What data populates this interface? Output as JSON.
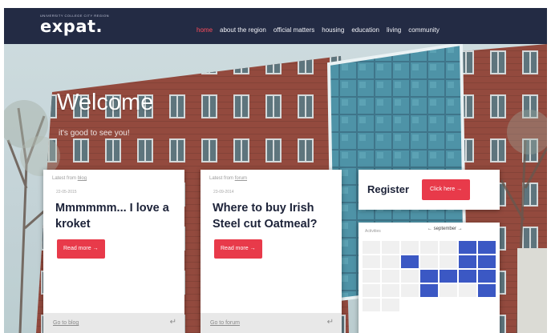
{
  "header": {
    "logo_tagline": "UNIVERSITY COLLEGE CITY REGION",
    "logo_text": "expat.",
    "nav": [
      "home",
      "about the region",
      "official matters",
      "housing",
      "education",
      "living",
      "community"
    ]
  },
  "hero": {
    "title": "Welcome",
    "subtitle": "it's good to see you!"
  },
  "cards": [
    {
      "latest_prefix": "Latest from",
      "latest_source": "blog",
      "date": "22-05-2015",
      "title": "Mmmmmm... I love a kroket",
      "button": "Read more →",
      "footer_link": "Go to blog",
      "footer_icon": "↵"
    },
    {
      "latest_prefix": "Latest from",
      "latest_source": "forum",
      "date": "23-09-2014",
      "title": "Where to buy Irish Steel cut Oatmeal?",
      "button": "Read more →",
      "footer_link": "Go to forum",
      "footer_icon": "↵"
    }
  ],
  "register": {
    "label": "Register",
    "button": "Click here →"
  },
  "calendar": {
    "label": "Activities",
    "month": "← september →"
  },
  "colors": {
    "header_bg": "#232b44",
    "accent_red": "#e83a4a",
    "calendar_blue": "#3b58c4"
  }
}
